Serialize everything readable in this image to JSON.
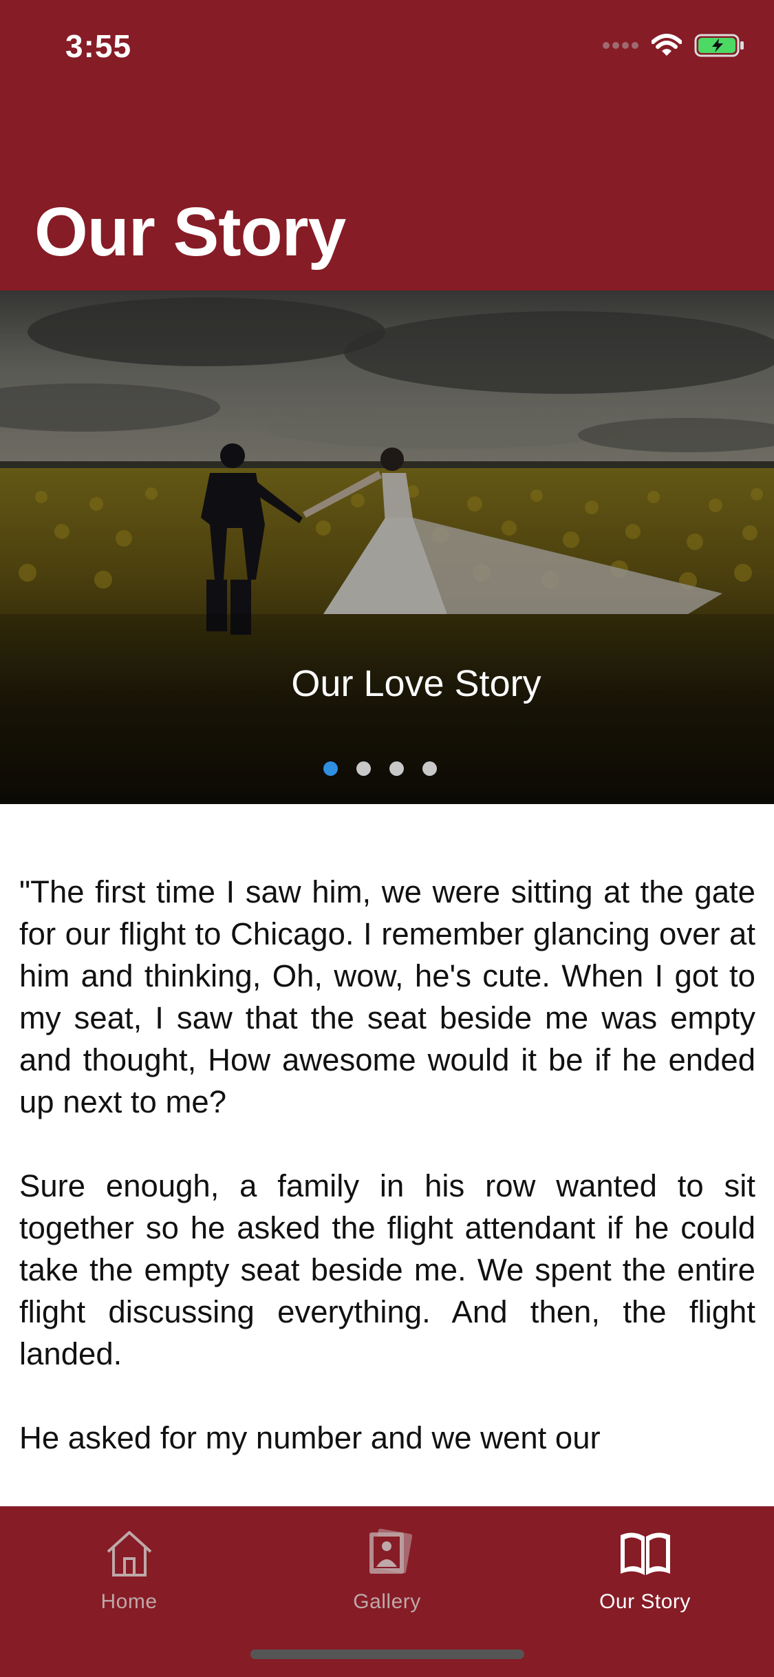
{
  "status_bar": {
    "time": "3:55",
    "icons": [
      "signal-dots-icon",
      "wifi-icon",
      "battery-charging-icon"
    ]
  },
  "header": {
    "title": "Our Story",
    "background_color": "#861c26"
  },
  "carousel": {
    "caption": "Our Love Story",
    "page_count": 4,
    "current_page": 1,
    "active_dot_color": "#2f8fe0"
  },
  "story": {
    "paragraphs": [
      "\"The first time I saw him, we were sitting at the gate for our flight to Chicago. I remember glancing over at him and thinking, Oh, wow, he's cute. When I got to my seat, I saw that the seat beside me was empty and thought, How awesome would it be if he ended up next to me?",
      "Sure enough, a family in his row wanted to sit together so he asked the flight attendant if he could take the empty seat beside me. We spent the entire flight discussing everything. And then, the flight landed.",
      "He asked for my number and we went our"
    ]
  },
  "tab_bar": {
    "tabs": [
      {
        "label": "Home",
        "icon": "home-icon",
        "active": false
      },
      {
        "label": "Gallery",
        "icon": "gallery-icon",
        "active": false
      },
      {
        "label": "Our Story",
        "icon": "book-icon",
        "active": true
      }
    ],
    "inactive_color": "#bfa8a9",
    "active_color": "#ffffff"
  }
}
